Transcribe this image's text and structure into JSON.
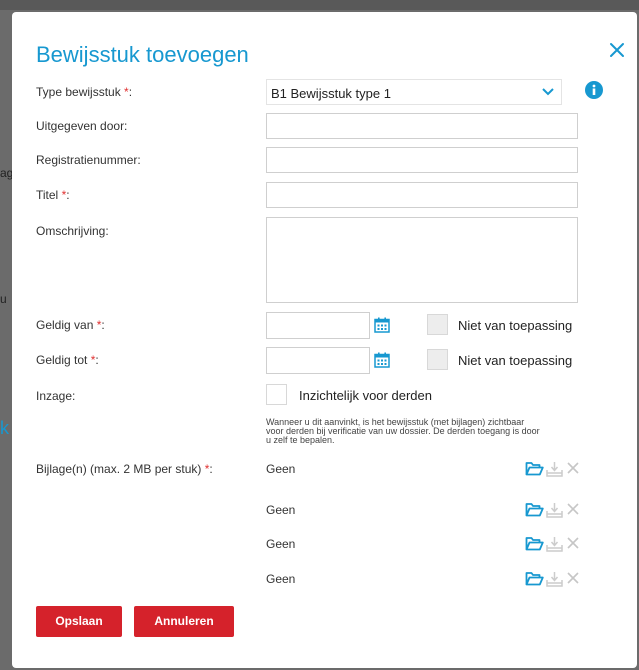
{
  "dialog": {
    "title": "Bewijsstuk toevoegen",
    "close_icon": "close-icon",
    "accent_color": "#1798d0",
    "required_marker": "*",
    "required_color": "#e03030"
  },
  "fields": {
    "type": {
      "label": "Type bewijsstuk",
      "suffix": ":",
      "value": "B1 Bewijsstuk type 1"
    },
    "issued_by": {
      "label": "Uitgegeven door:",
      "value": ""
    },
    "registration": {
      "label": "Registratienummer:",
      "value": ""
    },
    "title": {
      "label": "Titel",
      "suffix": ":",
      "value": ""
    },
    "description": {
      "label": "Omschrijving:",
      "value": ""
    },
    "valid_from": {
      "label": "Geldig van",
      "suffix": ":",
      "value": "",
      "not_applicable": "Niet van toepassing"
    },
    "valid_to": {
      "label": "Geldig tot",
      "suffix": ":",
      "value": "",
      "not_applicable": "Niet van toepassing"
    },
    "access": {
      "label": "Inzage:",
      "checkbox_label": "Inzichtelijk voor derden",
      "hint_line1": "Wanneer u dit aanvinkt, is het bewijsstuk (met bijlagen) zichtbaar",
      "hint_line2": "voor derden bij verificatie van uw dossier. De derden toegang is door",
      "hint_line3": "u zelf te bepalen."
    },
    "attachments": {
      "label": "Bijlage(n) (max. 2 MB per stuk)",
      "suffix": ":",
      "items": [
        "Geen",
        "Geen",
        "Geen",
        "Geen"
      ]
    }
  },
  "buttons": {
    "save": "Opslaan",
    "cancel": "Annuleren",
    "color": "#d5222b"
  },
  "backdrop": {
    "frag1": "ag",
    "frag2": "u",
    "frag3": "k"
  }
}
